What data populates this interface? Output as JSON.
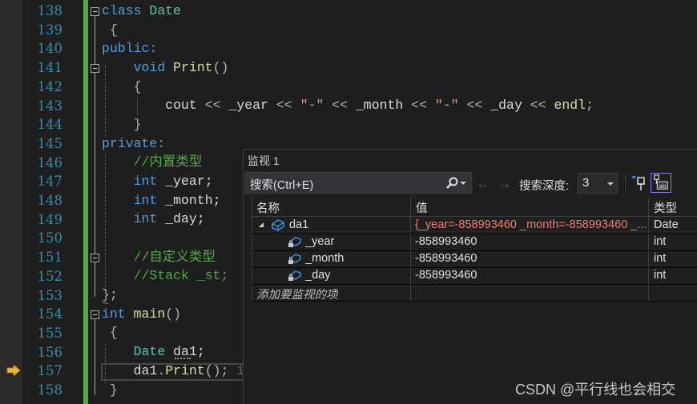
{
  "editor": {
    "line_numbers": [
      "138",
      "139",
      "140",
      "141",
      "142",
      "143",
      "144",
      "145",
      "146",
      "147",
      "148",
      "149",
      "150",
      "151",
      "152",
      "153",
      "154",
      "155",
      "156",
      "157",
      "158"
    ],
    "lines": {
      "l138": {
        "kw": "class",
        "name": "Date"
      },
      "l139": {
        "text": "{"
      },
      "l140": {
        "text": "public:"
      },
      "l141": {
        "kw": "void",
        "fn": "Print",
        "rest": "()"
      },
      "l142": {
        "text": "{"
      },
      "l143": {
        "cout": "cout",
        "op1": " << ",
        "v1": "_year",
        "op2": " << ",
        "s1": "\"-\"",
        "op3": " << ",
        "v2": "_month",
        "op4": " << ",
        "s2": "\"-\"",
        "op5": " << ",
        "v3": "_day",
        "op6": " << ",
        "endl": "endl",
        "end": ";"
      },
      "l144": {
        "text": "}"
      },
      "l145": {
        "text": "private:"
      },
      "l146": {
        "comment": "//内置类型"
      },
      "l147": {
        "kw": "int",
        "rest": " _year;"
      },
      "l148": {
        "kw": "int",
        "rest": " _month;"
      },
      "l149": {
        "kw": "int",
        "rest": " _day;"
      },
      "l151": {
        "comment": "//自定义类型"
      },
      "l152": {
        "comment": "//Stack _st;"
      },
      "l153": {
        "text": "};"
      },
      "l154": {
        "kw": "int",
        "fn": "main",
        "rest": "()"
      },
      "l155": {
        "text": "{"
      },
      "l156": {
        "type": "Date",
        "rest": " da1;"
      },
      "l157": {
        "var": "da1",
        "dot": ".",
        "fn": "Print",
        "rest": "(); ",
        "hint": "i"
      },
      "l158": {
        "text": "}"
      }
    },
    "current_line": "157"
  },
  "watch": {
    "title": "监视 1",
    "search_placeholder": "搜索(Ctrl+E)",
    "back_arrow": "←",
    "forward_arrow": "→",
    "search_depth_label": "搜索深度:",
    "search_depth_value": "3",
    "columns": {
      "name": "名称",
      "value": "值",
      "type": "类型"
    },
    "rows": [
      {
        "name": "da1",
        "value": "{_year=-858993460 _month=-858993460 _...",
        "type": "Date",
        "expanded": true
      },
      {
        "name": "_year",
        "value": "-858993460",
        "type": "int"
      },
      {
        "name": "_month",
        "value": "-858993460",
        "type": "int"
      },
      {
        "name": "_day",
        "value": "-858993460",
        "type": "int"
      }
    ],
    "add_item_placeholder": "添加要监视的项"
  },
  "watermark": "CSDN @平行线也会相交"
}
